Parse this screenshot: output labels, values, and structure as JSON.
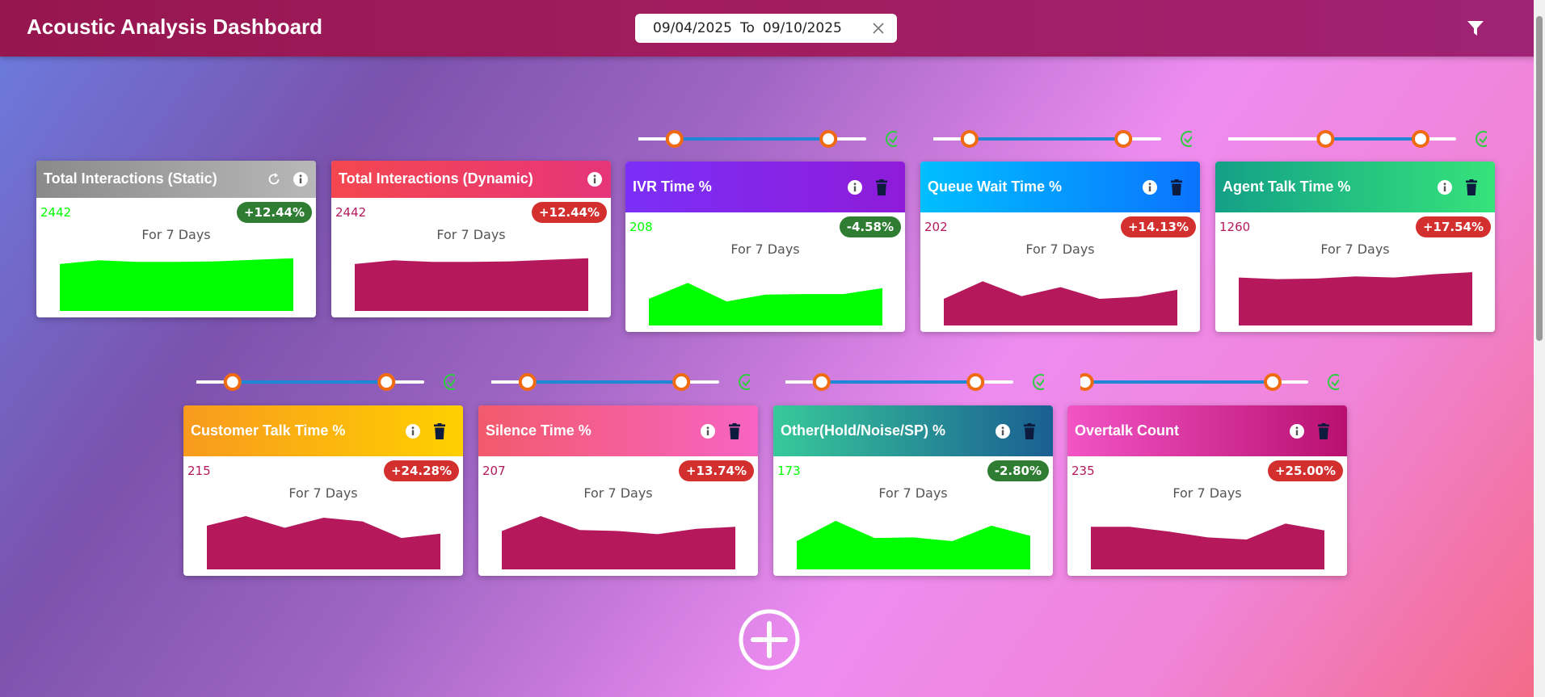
{
  "header": {
    "title": "Acoustic Analysis Dashboard"
  },
  "date_range": {
    "from": "09/04/2025",
    "separator": "To",
    "to": "09/10/2025"
  },
  "colors": {
    "positive_green": "#00ff00",
    "negative_maroon": "#b5195c",
    "badge_green": "#2e7d32",
    "badge_red": "#d32f2f"
  },
  "cards": [
    {
      "title": "Total Interactions (Static)",
      "value": "2442",
      "change": "+12.44%",
      "period": "For 7 Days",
      "icons": [
        "refresh-icon",
        "info-icon"
      ],
      "trend": "positive",
      "series": [
        0.88,
        0.95,
        0.92,
        0.92,
        0.93,
        0.96,
        0.99
      ]
    },
    {
      "title": "Total Interactions (Dynamic)",
      "value": "2442",
      "change": "+12.44%",
      "period": "For 7 Days",
      "icons": [
        "info-icon"
      ],
      "trend": "negative",
      "series": [
        0.88,
        0.95,
        0.92,
        0.92,
        0.93,
        0.96,
        0.99
      ]
    },
    {
      "title": "IVR Time %",
      "value": "208",
      "change": "-4.58%",
      "period": "For 7 Days",
      "icons": [
        "info-icon",
        "trash-icon"
      ],
      "trend": "positive",
      "series": [
        0.5,
        0.8,
        0.45,
        0.58,
        0.59,
        0.59,
        0.7
      ]
    },
    {
      "title": "Queue Wait Time %",
      "value": "202",
      "change": "+14.13%",
      "period": "For 7 Days",
      "icons": [
        "info-icon",
        "trash-icon"
      ],
      "trend": "negative",
      "series": [
        0.5,
        0.83,
        0.55,
        0.72,
        0.5,
        0.54,
        0.67
      ]
    },
    {
      "title": "Agent Talk Time %",
      "value": "1260",
      "change": "+17.54%",
      "period": "For 7 Days",
      "icons": [
        "info-icon",
        "trash-icon"
      ],
      "trend": "negative",
      "series": [
        0.9,
        0.87,
        0.88,
        0.92,
        0.9,
        0.96,
        1.0
      ]
    },
    {
      "title": "Customer Talk Time %",
      "value": "215",
      "change": "+24.28%",
      "period": "For 7 Days",
      "icons": [
        "info-icon",
        "trash-icon"
      ],
      "trend": "negative",
      "series": [
        0.82,
        1.0,
        0.78,
        0.97,
        0.9,
        0.59,
        0.67
      ]
    },
    {
      "title": "Silence Time %",
      "value": "207",
      "change": "+13.74%",
      "period": "For 7 Days",
      "icons": [
        "info-icon",
        "trash-icon"
      ],
      "trend": "negative",
      "series": [
        0.72,
        1.0,
        0.74,
        0.72,
        0.66,
        0.76,
        0.8
      ]
    },
    {
      "title": "Other(Hold/Noise/SP) %",
      "value": "173",
      "change": "-2.80%",
      "period": "For 7 Days",
      "icons": [
        "info-icon",
        "trash-icon"
      ],
      "trend": "positive",
      "series": [
        0.53,
        0.91,
        0.59,
        0.6,
        0.53,
        0.82,
        0.63
      ]
    },
    {
      "title": "Overtalk Count",
      "value": "235",
      "change": "+25.00%",
      "period": "For 7 Days",
      "icons": [
        "info-icon",
        "trash-icon"
      ],
      "trend": "negative",
      "series": [
        0.8,
        0.8,
        0.71,
        0.6,
        0.56,
        0.86,
        0.73
      ]
    }
  ],
  "sliders": [
    {
      "range": [
        0.16,
        0.84
      ]
    },
    {
      "range": [
        0.16,
        0.84
      ]
    },
    {
      "range": [
        0.43,
        0.85
      ]
    },
    {
      "range": [
        0.16,
        0.84
      ]
    },
    {
      "range": [
        0.16,
        0.84
      ]
    },
    {
      "range": [
        0.16,
        0.84
      ]
    },
    {
      "range": [
        0.02,
        0.85
      ]
    }
  ]
}
